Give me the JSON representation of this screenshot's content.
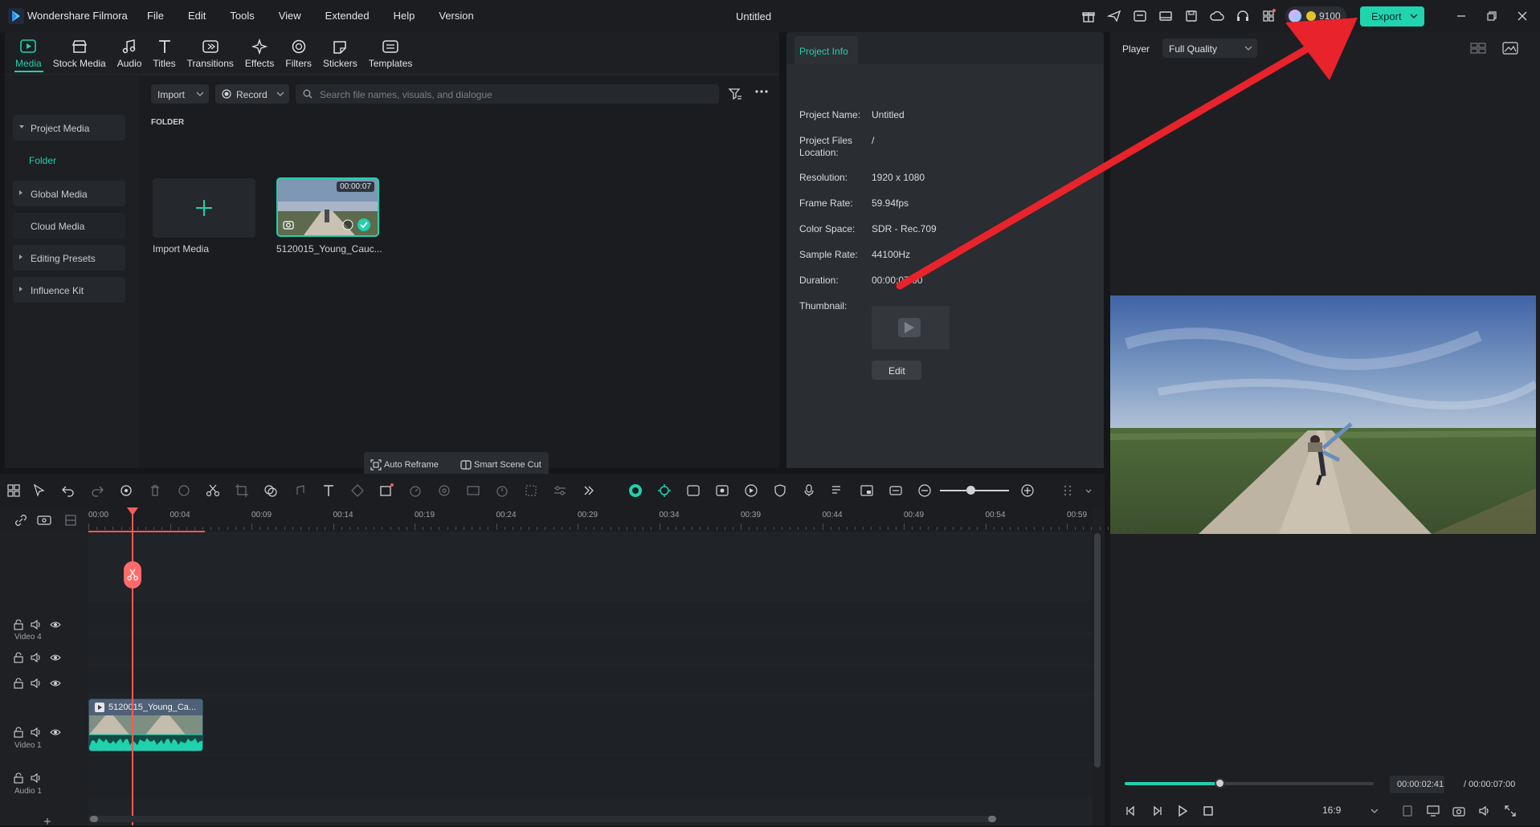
{
  "titlebar": {
    "app_name": "Wondershare Filmora",
    "menu": [
      "File",
      "Edit",
      "Tools",
      "View",
      "Extended",
      "Help",
      "Version"
    ],
    "doc_title": "Untitled",
    "credits": "9100",
    "export_label": "Export"
  },
  "tabs": [
    {
      "label": "Media"
    },
    {
      "label": "Stock Media"
    },
    {
      "label": "Audio"
    },
    {
      "label": "Titles"
    },
    {
      "label": "Transitions"
    },
    {
      "label": "Effects"
    },
    {
      "label": "Filters"
    },
    {
      "label": "Stickers"
    },
    {
      "label": "Templates"
    }
  ],
  "sidebar": {
    "project_media": "Project Media",
    "folder": "Folder",
    "global_media": "Global Media",
    "cloud_media": "Cloud Media",
    "editing_presets": "Editing Presets",
    "influence_kit": "Influence Kit"
  },
  "media": {
    "import_label": "Import",
    "record_label": "Record",
    "search_placeholder": "Search file names, visuals, and dialogue",
    "folder_heading": "FOLDER",
    "import_media": "Import Media",
    "clip_name": "5120015_Young_Cauc...",
    "clip_duration": "00:00:07",
    "auto_reframe": "Auto Reframe",
    "smart_scene_cut": "Smart Scene Cut"
  },
  "project_info": {
    "tab": "Project Info",
    "fields": [
      {
        "key": "Project Name:",
        "value": "Untitled"
      },
      {
        "key": "Project Files Location:",
        "value": "/"
      },
      {
        "key": "Resolution:",
        "value": "1920 x 1080"
      },
      {
        "key": "Frame Rate:",
        "value": "59.94fps"
      },
      {
        "key": "Color Space:",
        "value": "SDR - Rec.709"
      },
      {
        "key": "Sample Rate:",
        "value": "44100Hz"
      },
      {
        "key": "Duration:",
        "value": "00:00:07:00"
      },
      {
        "key": "Thumbnail:",
        "value": ""
      }
    ],
    "edit_label": "Edit"
  },
  "player": {
    "label": "Player",
    "quality": "Full Quality",
    "current_time": "00:00:02:41",
    "total_time": "/ 00:00:07:00",
    "aspect": "16:9",
    "progress_fraction": 0.38
  },
  "timeline": {
    "ticks": [
      "00:00",
      "00:04",
      "00:09",
      "00:14",
      "00:19",
      "00:24",
      "00:29",
      "00:34",
      "00:39",
      "00:44",
      "00:49",
      "00:54",
      "00:59"
    ],
    "tracks": {
      "video4": "Video 4",
      "video1": "Video 1",
      "audio1": "Audio 1"
    },
    "clip_label": "5120015_Young_Ca..."
  },
  "colors": {
    "accent": "#21d0ad",
    "playhead": "#ff5a5a",
    "annotation_arrow": "#e8232b"
  }
}
